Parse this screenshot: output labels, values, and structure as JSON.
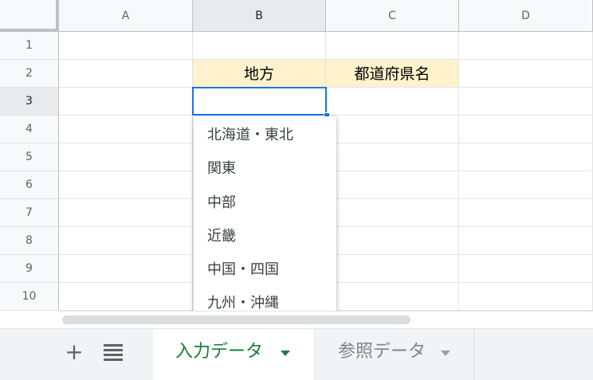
{
  "columns": [
    "A",
    "B",
    "C",
    "D"
  ],
  "rows": [
    "1",
    "2",
    "3",
    "4",
    "5",
    "6",
    "7",
    "8",
    "9",
    "10"
  ],
  "cells": {
    "B2": "地方",
    "C2": "都道府県名"
  },
  "dropdown": {
    "options": [
      "北海道・東北",
      "関東",
      "中部",
      "近畿",
      "中国・四国",
      "九州・沖縄"
    ]
  },
  "sheets": {
    "add_icon": "+",
    "tabs": [
      {
        "label": "入力データ"
      },
      {
        "label": "参照データ"
      }
    ]
  },
  "colors": {
    "header_fill": "#fff2cc",
    "selection": "#1a73e8",
    "active_tab_text": "#188038"
  }
}
